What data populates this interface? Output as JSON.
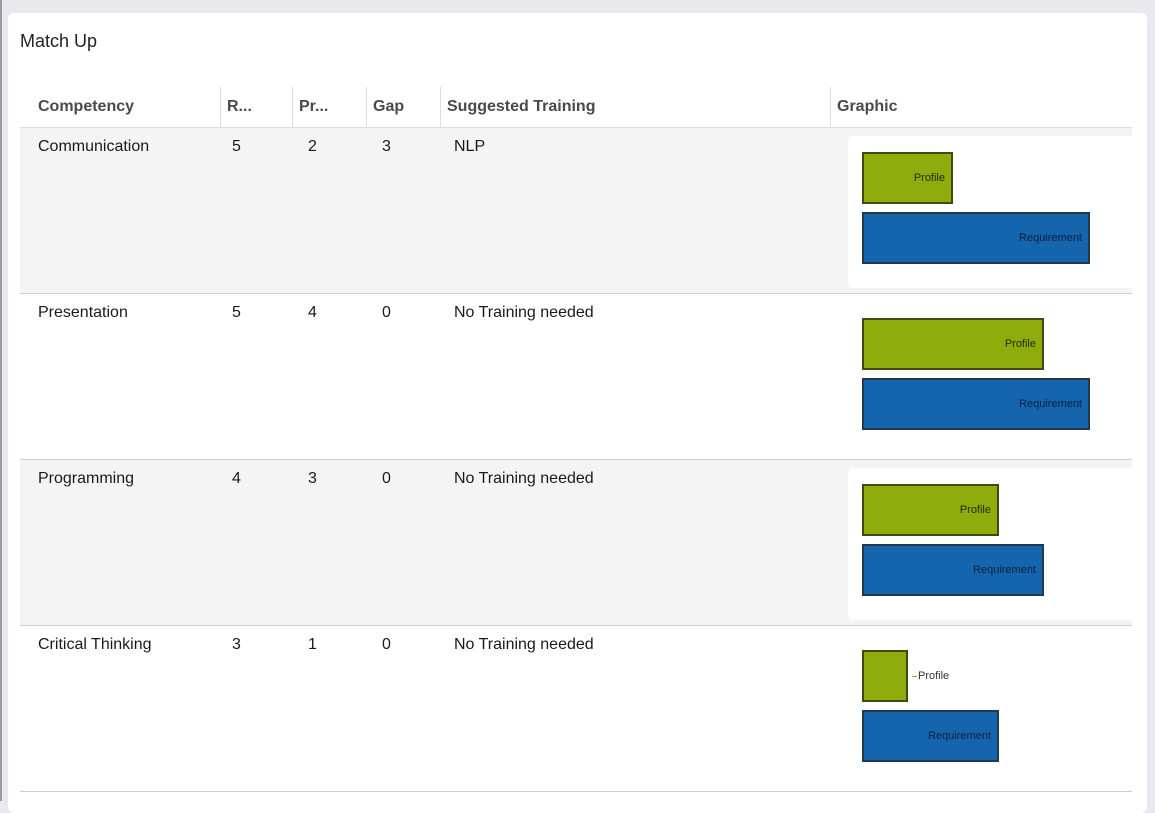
{
  "panel": {
    "title": "Match Up"
  },
  "columns": {
    "competency": "Competency",
    "requirement": "R...",
    "profile": "Pr...",
    "gap": "Gap",
    "training": "Suggested Training",
    "graphic": "Graphic"
  },
  "graphic_labels": {
    "profile": "Profile",
    "requirement": "Requirement"
  },
  "rows": [
    {
      "competency": "Communication",
      "requirement": "5",
      "profile": "2",
      "gap": "3",
      "training": "NLP"
    },
    {
      "competency": "Presentation",
      "requirement": "5",
      "profile": "4",
      "gap": "0",
      "training": "No Training needed"
    },
    {
      "competency": "Programming",
      "requirement": "4",
      "profile": "3",
      "gap": "0",
      "training": "No Training needed"
    },
    {
      "competency": "Critical Thinking",
      "requirement": "3",
      "profile": "1",
      "gap": "0",
      "training": "No Training needed"
    }
  ],
  "colors": {
    "profile_bar": "#8fac0d",
    "requirement_bar": "#1565ae"
  }
}
